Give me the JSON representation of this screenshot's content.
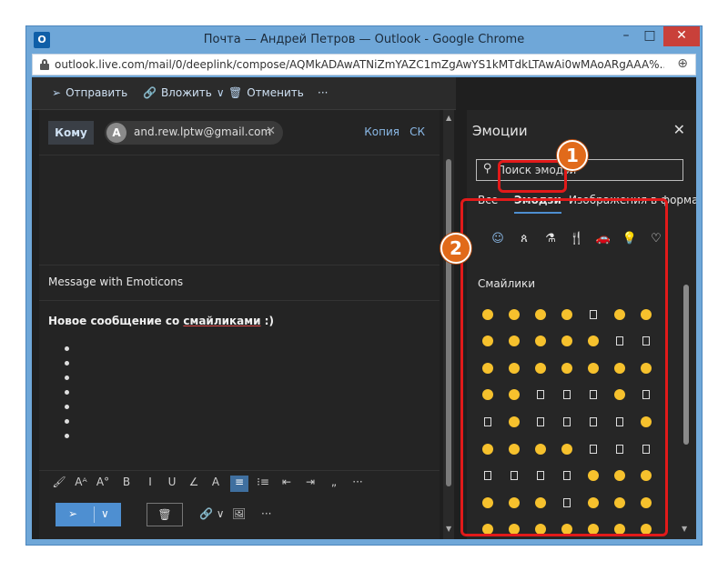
{
  "window": {
    "title": "Почта — Андрей Петров — Outlook - Google Chrome",
    "url": "outlook.live.com/mail/0/deeplink/compose/AQMkADAwATNiZmYAZC1mZgAwYS1kMTdkLTAwAi0wMAoARgAAA%...",
    "app_icon_text": "O",
    "min_label": "–",
    "max_label": "□",
    "close_label": "✕",
    "new_tab_label": "⊕"
  },
  "toolbar": {
    "send_label": "Отправить",
    "attach_label": "Вложить",
    "discard_label": "Отменить",
    "more_label": "···"
  },
  "compose": {
    "to_label": "Кому",
    "recipient_initial": "A",
    "recipient_email": "and.rew.lptw@gmail.com",
    "remove_recipient": "✕",
    "cc_label": "Копия",
    "bcc_label": "СК",
    "subject": "Message with Emoticons",
    "body_text_before": "Новое сообщение со ",
    "body_text_underlined": "смайликами",
    "body_text_after": " :)",
    "bullet_count": 7
  },
  "format_bar": {
    "items": [
      "🖌",
      "Aᴬ",
      "A°",
      "B",
      "I",
      "U",
      "∠",
      "A",
      "≡",
      "⁝≡",
      "⇤",
      "⇥",
      "„",
      "···"
    ]
  },
  "send_row": {
    "send_arrow": "➢",
    "chevron": "∨",
    "trash": "🗑",
    "attach": "🔗 ∨",
    "image": "🖼",
    "more": "···"
  },
  "emoji_panel": {
    "title": "Эмоции",
    "close": "✕",
    "search_placeholder": "Поиск эмодзи",
    "tabs": [
      "Все",
      "Эмодзи",
      "Изображения в формате GIF"
    ],
    "selected_tab": "Эмодзи",
    "categories": [
      "☺",
      "ጰ",
      "⚗",
      "🍴",
      "🚗",
      "💡",
      "♡"
    ],
    "section_label": "Смайлики",
    "grid": [
      [
        "face",
        "face",
        "face",
        "face",
        "box",
        "face",
        "face"
      ],
      [
        "face",
        "face",
        "face",
        "face",
        "face",
        "box",
        "box"
      ],
      [
        "face",
        "face",
        "face",
        "face",
        "face",
        "face",
        "face"
      ],
      [
        "face",
        "face",
        "box",
        "box",
        "box",
        "face",
        "box"
      ],
      [
        "box",
        "face",
        "box",
        "box",
        "box",
        "box",
        "face"
      ],
      [
        "face",
        "face",
        "face",
        "face",
        "box",
        "box",
        "box"
      ],
      [
        "box",
        "box",
        "box",
        "box",
        "face",
        "face",
        "face"
      ],
      [
        "face",
        "face",
        "face",
        "box",
        "face",
        "face",
        "face"
      ],
      [
        "face",
        "face",
        "face",
        "face",
        "face",
        "face",
        "face"
      ],
      [
        "face",
        "face",
        "face",
        "face",
        "box",
        "face",
        "face"
      ]
    ]
  },
  "annotations": {
    "badge_1": "1",
    "badge_2": "2",
    "highlight_color": "#e21a1a",
    "badge_color": "#e16a1a"
  }
}
